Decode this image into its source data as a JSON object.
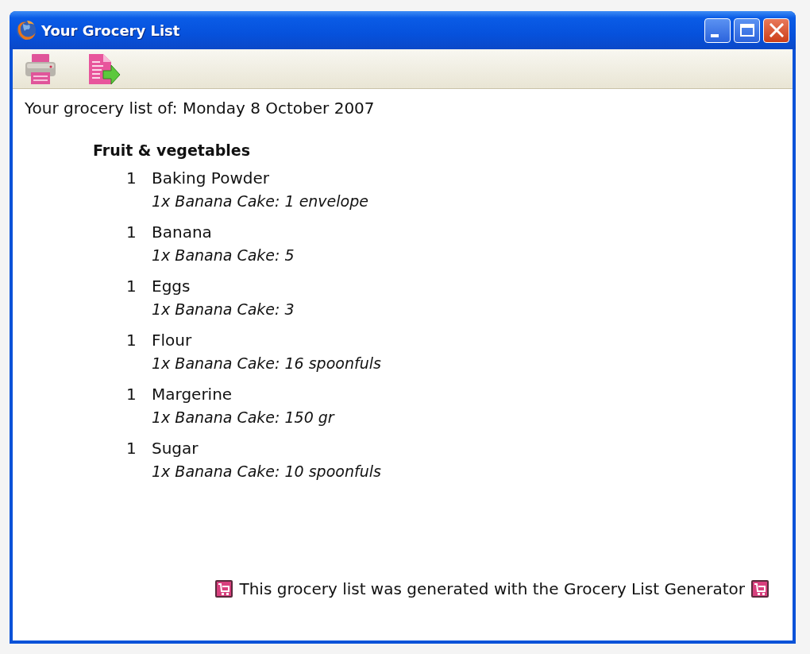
{
  "window": {
    "title": "Your Grocery List"
  },
  "list": {
    "date_line": "Your grocery list of: Monday 8 October 2007",
    "categories": [
      {
        "name": "Fruit & vegetables",
        "items": [
          {
            "quantity": "1",
            "name": "Baking Powder",
            "note": "1x Banana Cake: 1 envelope"
          },
          {
            "quantity": "1",
            "name": "Banana",
            "note": "1x Banana Cake: 5"
          },
          {
            "quantity": "1",
            "name": "Eggs",
            "note": "1x Banana Cake: 3"
          },
          {
            "quantity": "1",
            "name": "Flour",
            "note": "1x Banana Cake: 16 spoonfuls"
          },
          {
            "quantity": "1",
            "name": "Margerine",
            "note": "1x Banana Cake: 150 gr"
          },
          {
            "quantity": "1",
            "name": "Sugar",
            "note": "1x Banana Cake: 10 spoonfuls"
          }
        ]
      }
    ]
  },
  "footer": {
    "text": "This grocery list was generated with the Grocery List Generator"
  }
}
